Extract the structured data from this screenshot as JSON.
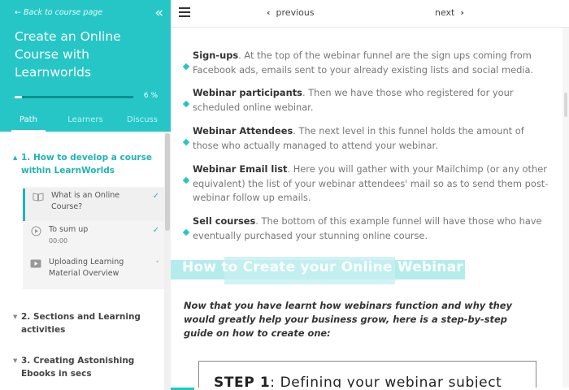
{
  "sidebar": {
    "back_label": "Back to course page",
    "course_title": "Create an Online Course with Learnworlds",
    "progress_percent": 6,
    "progress_text": "6 %",
    "tabs": [
      {
        "label": "Path",
        "active": true
      },
      {
        "label": "Learners",
        "active": false
      },
      {
        "label": "Discuss",
        "active": false
      }
    ],
    "sections": [
      {
        "label": "1. How to develop a course within LearnWorlds",
        "open": true
      },
      {
        "label": "2. Sections and Learning activities",
        "open": false
      },
      {
        "label": "3. Creating Astonishing Ebooks in secs",
        "open": false
      }
    ],
    "lessons": [
      {
        "title": "What is an Online Course?",
        "sub": "",
        "icon": "book-icon",
        "status": "✓"
      },
      {
        "title": "To sum up",
        "sub": "00:00",
        "icon": "play-circle-icon",
        "status": "✓"
      },
      {
        "title": "Uploading Learning Material Overview",
        "sub": "",
        "icon": "video-icon",
        "status": "•"
      }
    ]
  },
  "topbar": {
    "previous_label": "previous",
    "next_label": "next"
  },
  "content": {
    "bullets": [
      {
        "term": "Sign-ups",
        "text": ". At the top of the webinar funnel are the sign ups coming from Facebook ads, emails sent to your already existing lists and social media."
      },
      {
        "term": "Webinar participants",
        "text": ". Then we have those who registered for your scheduled online webinar."
      },
      {
        "term": "Webinar Attendees",
        "text": ". The next level in this funnel holds the amount of those who actually managed to attend your webinar."
      },
      {
        "term": "Webinar Email list",
        "text": ". Here you will gather with your Mailchimp (or any other equivalent) the list of your webinar attendees' mail so as to send them post-webinar follow up emails."
      },
      {
        "term": "Sell courses",
        "text": ". The bottom of this example funnel will have those who have eventually purchased your stunning online course."
      }
    ],
    "heading": "How to Create your Online Webinar",
    "intro": "Now that you have learnt how webinars function and why they would greatly help your business grow, here is a step-by-step guide on how to create one:",
    "step_label": "STEP 1",
    "step_text": ": Defining your webinar subject"
  },
  "colors": {
    "accent": "#26c6c6",
    "accent_dark": "#1fb5b5"
  }
}
